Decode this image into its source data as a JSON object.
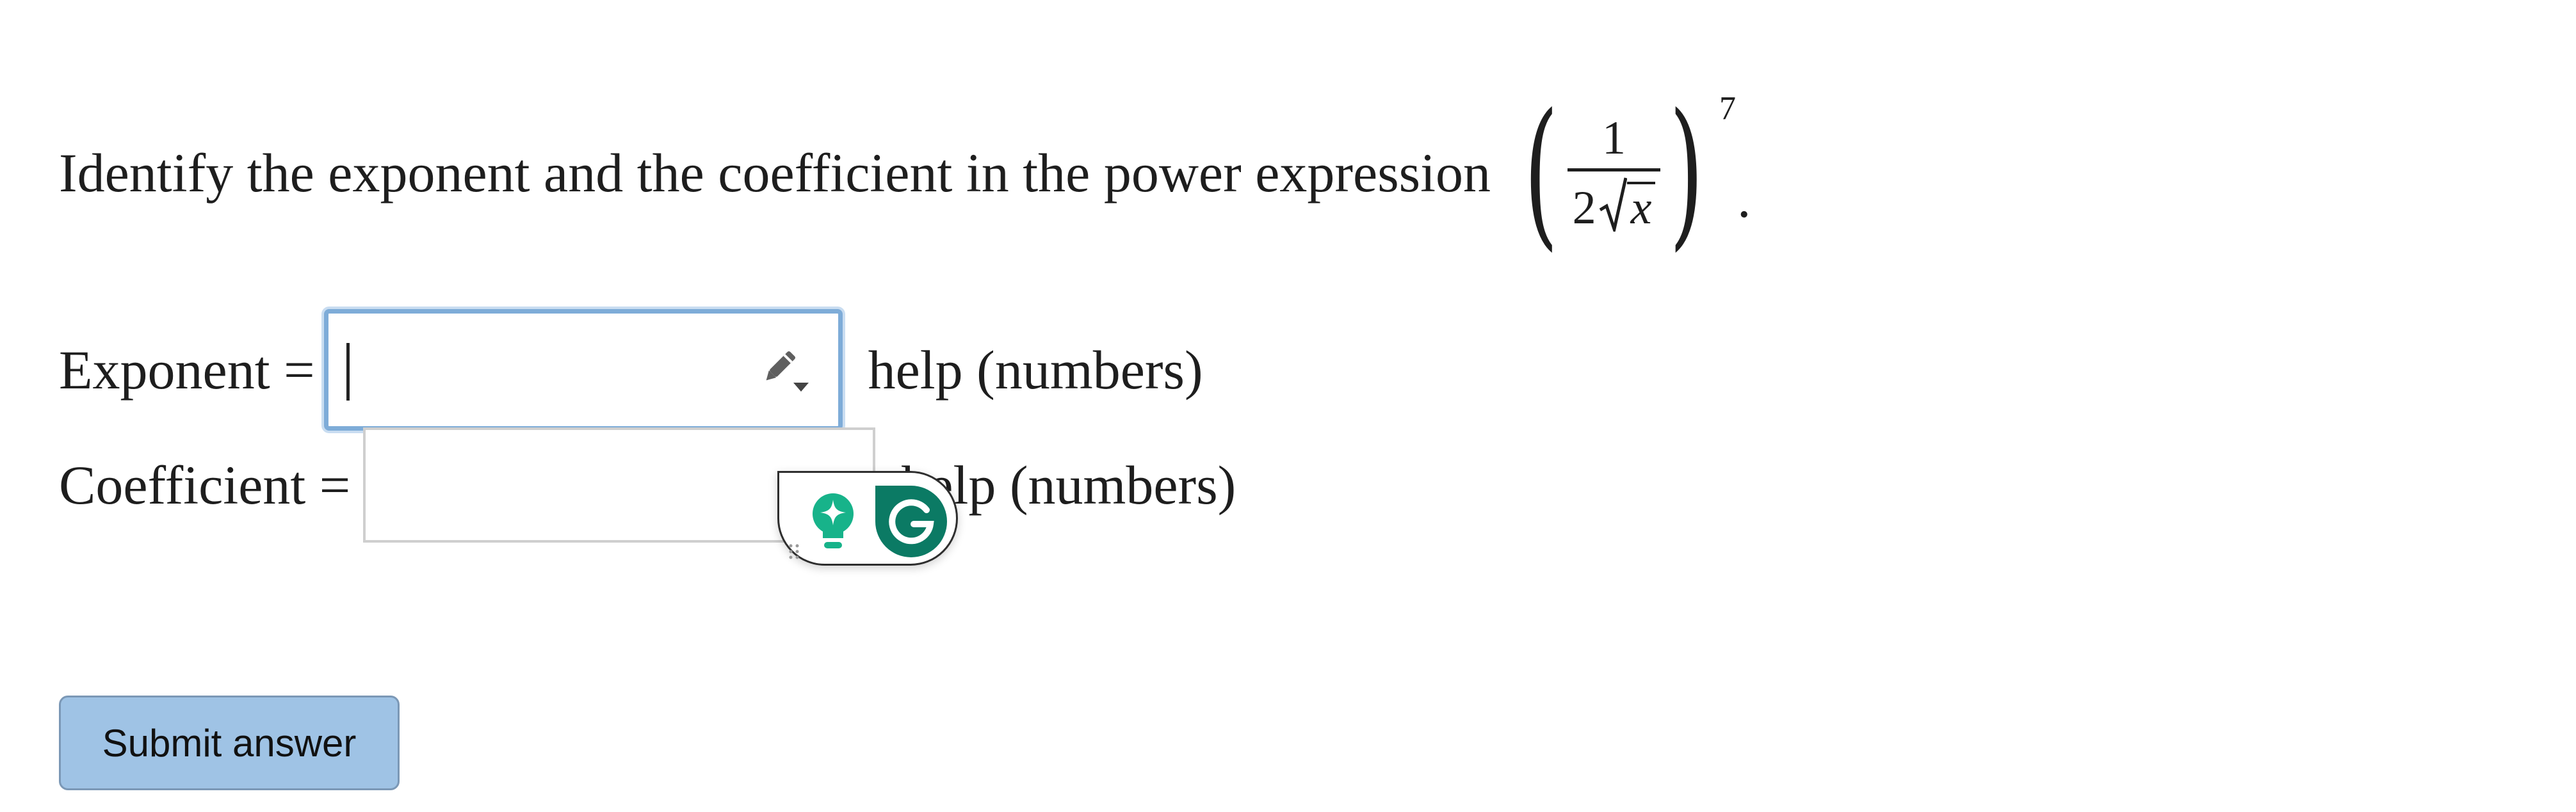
{
  "question": {
    "text": "Identify the exponent and the coefficient in the power expression",
    "expr_numerator": "1",
    "expr_den_coef": "2",
    "expr_radicand": "x",
    "expr_exponent": "7",
    "period": "."
  },
  "exponent_row": {
    "label": "Exponent =",
    "value": "",
    "help": "help (numbers)"
  },
  "coefficient_row": {
    "label": "Coefficient =",
    "value": "",
    "help": "help (numbers)"
  },
  "submit_label": "Submit answer",
  "icons": {
    "pencil": "pencil-dropdown-icon",
    "bulb": "lightbulb-sparkle-icon",
    "grammarly": "grammarly-g-icon",
    "grip": "drag-grip-icon"
  },
  "colors": {
    "focus_border": "#7eacd8",
    "button_bg": "#9fc3e5",
    "grammarly_green": "#0b7a64",
    "bulb_teal": "#17b38a"
  }
}
